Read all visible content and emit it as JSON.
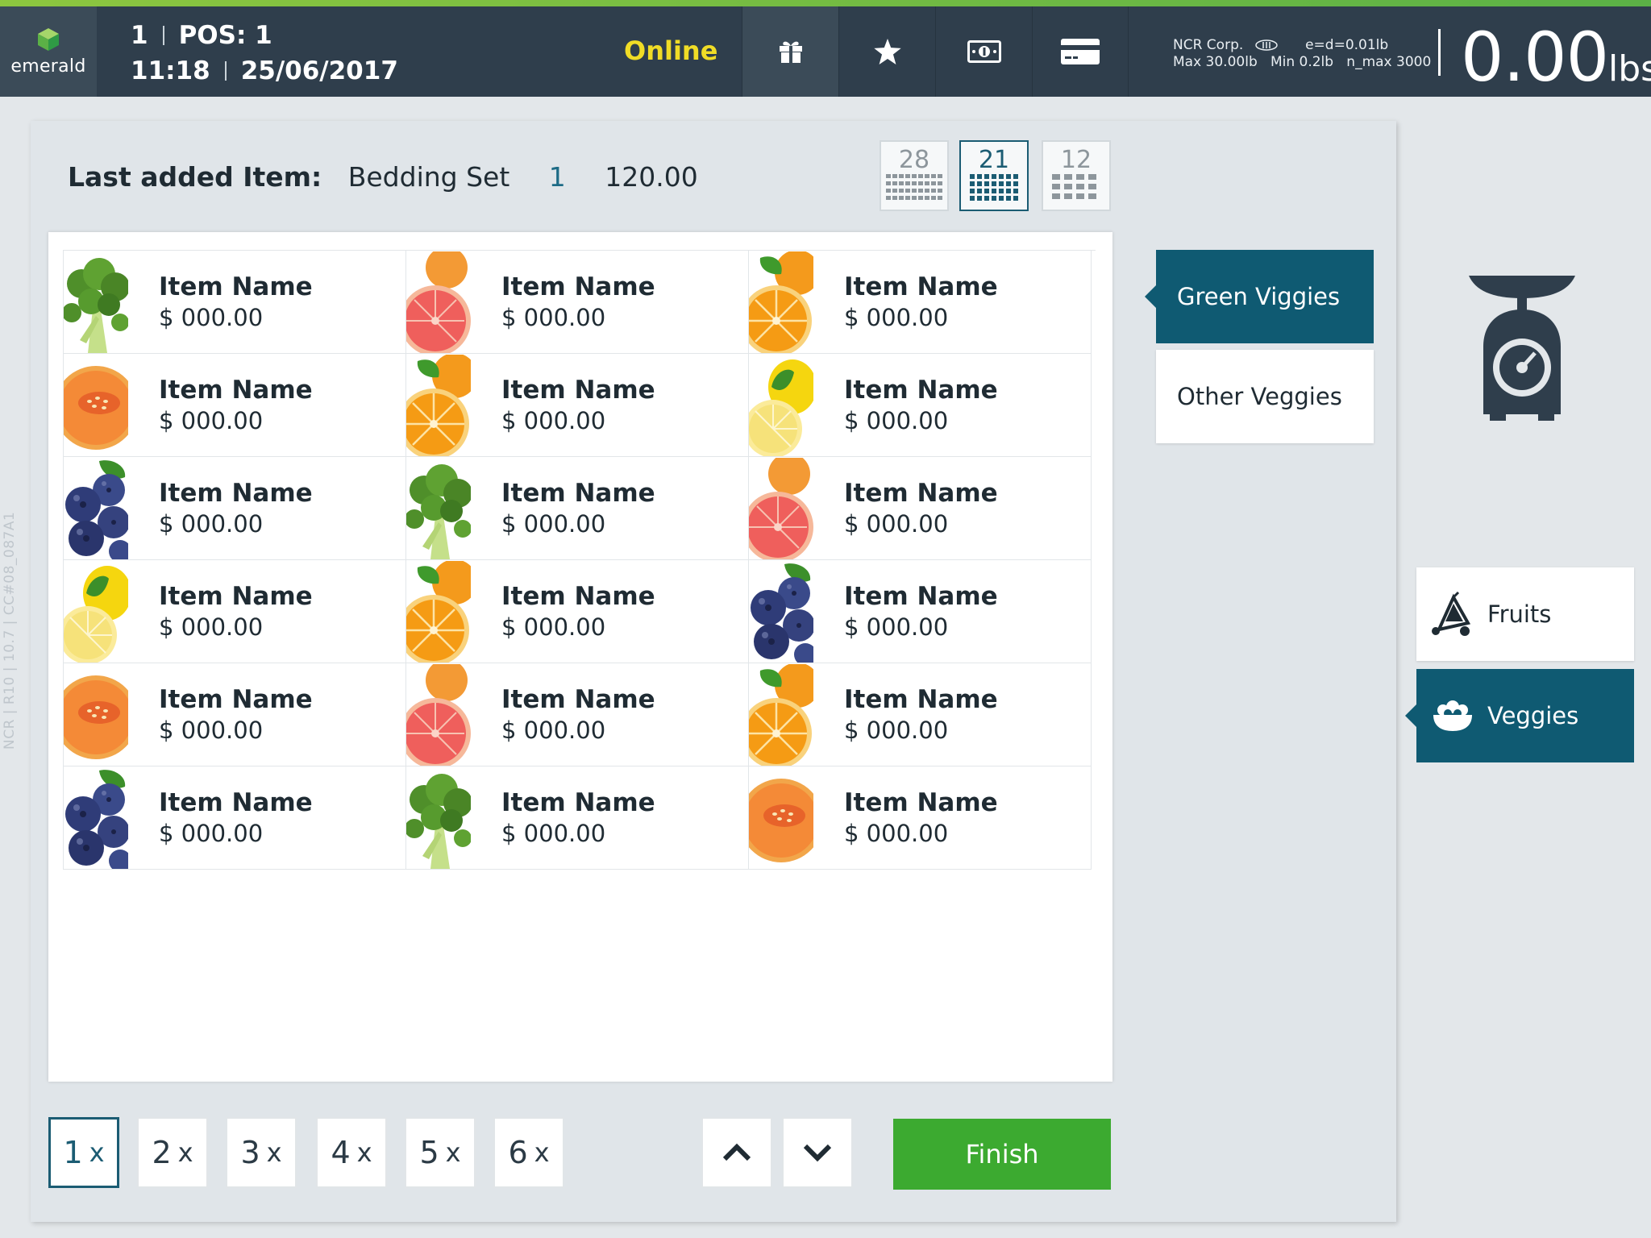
{
  "header": {
    "logo_text": "emerald",
    "terminal": "1",
    "pos": "POS: 1",
    "time": "11:18",
    "date": "25/06/2017",
    "status": "Online",
    "scale_vendor": "NCR Corp.",
    "scale_ed": "e=d=0.01lb",
    "scale_max": "Max 30.00lb",
    "scale_min": "Min 0.2lb",
    "scale_nmax": "n_max 3000",
    "weight_value": "0.00",
    "weight_unit": "lbs",
    "icons": [
      "gift-icon",
      "star-icon",
      "cash-icon",
      "card-icon"
    ]
  },
  "side_id": "NCR | R10 | 10.7 | CC#08_087A1",
  "last_added": {
    "label": "Last added Item:",
    "name": "Bedding Set",
    "qty": "1",
    "price": "120.00"
  },
  "grid_options": [
    {
      "label": "28",
      "active": false
    },
    {
      "label": "21",
      "active": true
    },
    {
      "label": "12",
      "active": false
    }
  ],
  "items": [
    {
      "name": "Item Name",
      "price": "$ 000.00",
      "fruit": "broccoli"
    },
    {
      "name": "Item Name",
      "price": "$ 000.00",
      "fruit": "grapefruit"
    },
    {
      "name": "Item Name",
      "price": "$ 000.00",
      "fruit": "orange"
    },
    {
      "name": "Item Name",
      "price": "$ 000.00",
      "fruit": "melon"
    },
    {
      "name": "Item Name",
      "price": "$ 000.00",
      "fruit": "orange"
    },
    {
      "name": "Item Name",
      "price": "$ 000.00",
      "fruit": "lemon"
    },
    {
      "name": "Item Name",
      "price": "$ 000.00",
      "fruit": "blueberry"
    },
    {
      "name": "Item Name",
      "price": "$ 000.00",
      "fruit": "broccoli"
    },
    {
      "name": "Item Name",
      "price": "$ 000.00",
      "fruit": "grapefruit"
    },
    {
      "name": "Item Name",
      "price": "$ 000.00",
      "fruit": "lemon"
    },
    {
      "name": "Item Name",
      "price": "$ 000.00",
      "fruit": "orange"
    },
    {
      "name": "Item Name",
      "price": "$ 000.00",
      "fruit": "blueberry"
    },
    {
      "name": "Item Name",
      "price": "$ 000.00",
      "fruit": "melon"
    },
    {
      "name": "Item Name",
      "price": "$ 000.00",
      "fruit": "grapefruit"
    },
    {
      "name": "Item Name",
      "price": "$ 000.00",
      "fruit": "orange"
    },
    {
      "name": "Item Name",
      "price": "$ 000.00",
      "fruit": "blueberry"
    },
    {
      "name": "Item Name",
      "price": "$ 000.00",
      "fruit": "broccoli"
    },
    {
      "name": "Item Name",
      "price": "$ 000.00",
      "fruit": "melon"
    }
  ],
  "quantity_buttons": [
    {
      "num": "1",
      "x": "x",
      "active": true
    },
    {
      "num": "2",
      "x": "x",
      "active": false
    },
    {
      "num": "3",
      "x": "x",
      "active": false
    },
    {
      "num": "4",
      "x": "x",
      "active": false
    },
    {
      "num": "5",
      "x": "x",
      "active": false
    },
    {
      "num": "6",
      "x": "x",
      "active": false
    }
  ],
  "nav": {
    "up_icon": "chevron-up-icon",
    "down_icon": "chevron-down-icon"
  },
  "finish_label": "Finish",
  "subcategories": [
    {
      "label": "Green Viggies",
      "active": true
    },
    {
      "label": "Other Veggies",
      "active": false
    }
  ],
  "categories": [
    {
      "label": "Fruits",
      "icon": "fruits-icon",
      "active": false
    },
    {
      "label": "Veggies",
      "icon": "veggies-bowl-icon",
      "active": true
    }
  ],
  "colors": {
    "header_bg": "#2f3e4c",
    "accent_teal": "#0f5a72",
    "online_yellow": "#f0dc26",
    "finish_green": "#3caa30",
    "top_accent": "#8dc63f"
  }
}
